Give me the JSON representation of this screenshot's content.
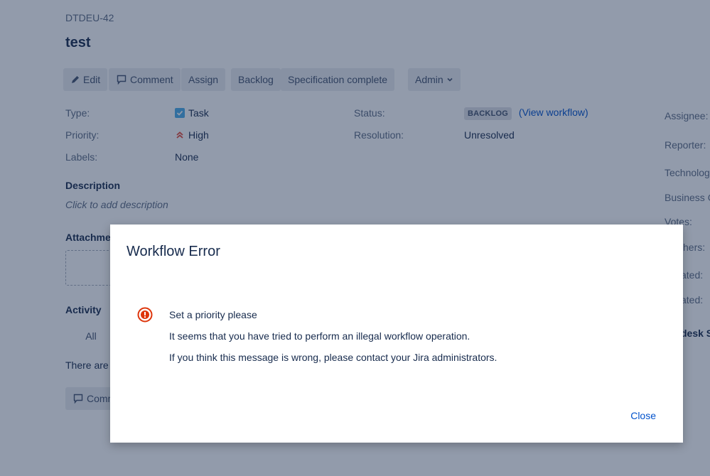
{
  "issue": {
    "key": "DTDEU-42",
    "title": "test"
  },
  "toolbar": {
    "edit_label": "Edit",
    "comment_label": "Comment",
    "assign_label": "Assign",
    "backlog_label": "Backlog",
    "spec_complete_label": "Specification complete",
    "admin_label": "Admin"
  },
  "details": {
    "type_label": "Type:",
    "type_value": "Task",
    "priority_label": "Priority:",
    "priority_value": "High",
    "labels_label": "Labels:",
    "labels_value": "None",
    "status_label": "Status:",
    "status_value": "BACKLOG",
    "view_workflow": "(View workflow)",
    "resolution_label": "Resolution:",
    "resolution_value": "Unresolved"
  },
  "people": {
    "assignee_label": "Assignee:",
    "reporter_label": "Reporter:",
    "technology_label": "Technolog",
    "business_label": "Business C",
    "votes_label": "Votes:",
    "watchers_label": "chers:",
    "created_label": "ated:",
    "updated_label": "ated:",
    "servicedesk_label": "desk S"
  },
  "description": {
    "heading": "Description",
    "placeholder": "Click to add description"
  },
  "attachments": {
    "heading": "Attachme"
  },
  "activity": {
    "heading": "Activity",
    "tab_all": "All",
    "no_comments_text": "There are",
    "comment_button": "Comm"
  },
  "dialog": {
    "title": "Workflow Error",
    "message_title": "Set a priority please",
    "message_line1": "It seems that you have tried to perform an illegal workflow operation.",
    "message_line2": "If you think this message is wrong, please contact your Jira administrators.",
    "close_label": "Close",
    "icon": "error-icon"
  },
  "colors": {
    "overlay": "#172b4d",
    "link": "#0052cc",
    "error": "#de350b",
    "task": "#4bade8",
    "priority_high": "#e5493a"
  }
}
